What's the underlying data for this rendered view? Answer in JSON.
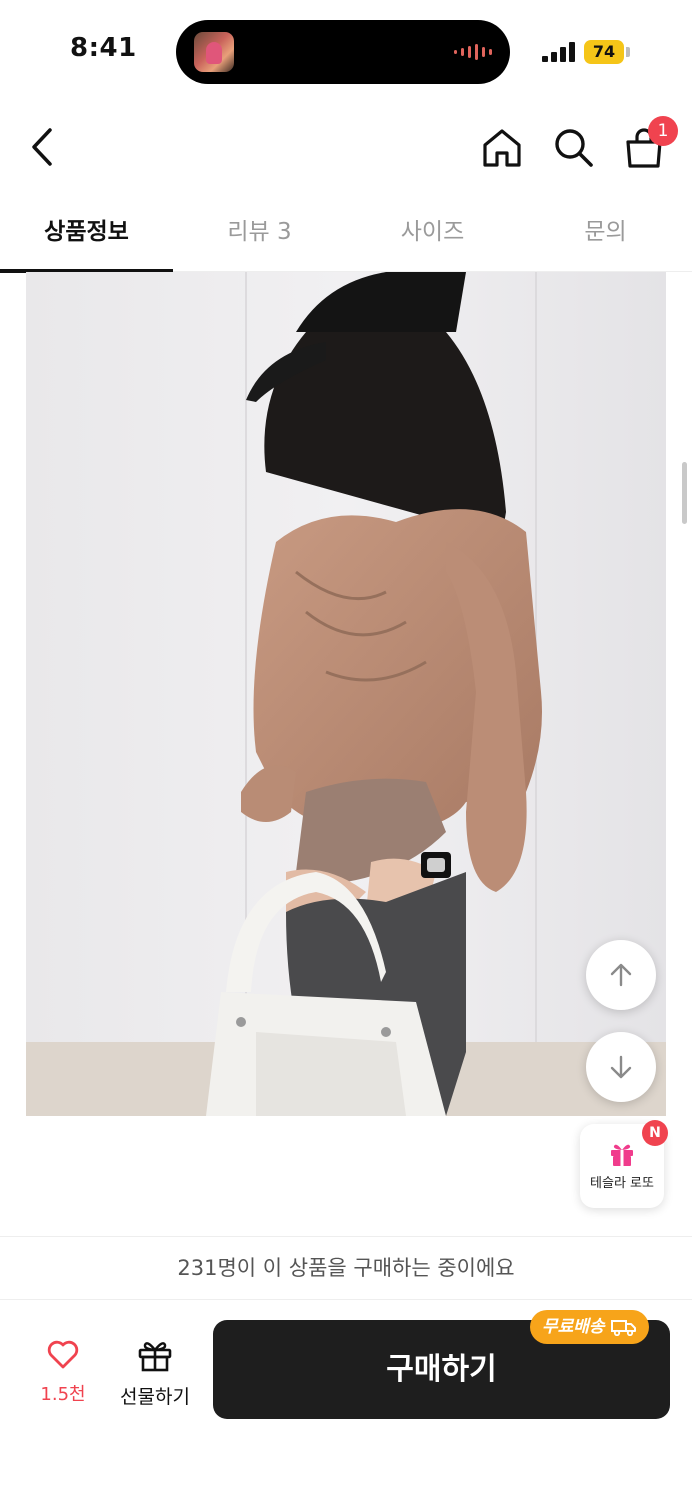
{
  "status_bar": {
    "time": "8:41",
    "battery_level": "74",
    "battery_color": "#f5c518"
  },
  "nav": {
    "back_icon": "chevron-left-icon",
    "home_icon": "home-icon",
    "search_icon": "search-icon",
    "cart_icon": "shopping-bag-icon",
    "cart_badge": "1"
  },
  "tabs": [
    {
      "label": "상품정보",
      "active": true
    },
    {
      "label": "리뷰 3",
      "active": false
    },
    {
      "label": "사이즈",
      "active": false
    },
    {
      "label": "문의",
      "active": false
    }
  ],
  "floating": {
    "scroll_up_icon": "arrow-up-icon",
    "scroll_down_icon": "arrow-down-icon",
    "lotto_label": "테슬라 로또",
    "lotto_badge": "N",
    "lotto_icon": "gift-icon"
  },
  "purchase": {
    "buyers_notice": "231명이 이 상품을 구매하는 중이에요",
    "like_count": "1.5천",
    "like_icon": "heart-icon",
    "gift_label": "선물하기",
    "gift_icon": "gift-icon",
    "buy_label": "구매하기",
    "free_shipping_label": "무료배송",
    "free_shipping_icon": "truck-icon",
    "accent_color": "#f0434f",
    "badge_color": "#f7a41a"
  }
}
